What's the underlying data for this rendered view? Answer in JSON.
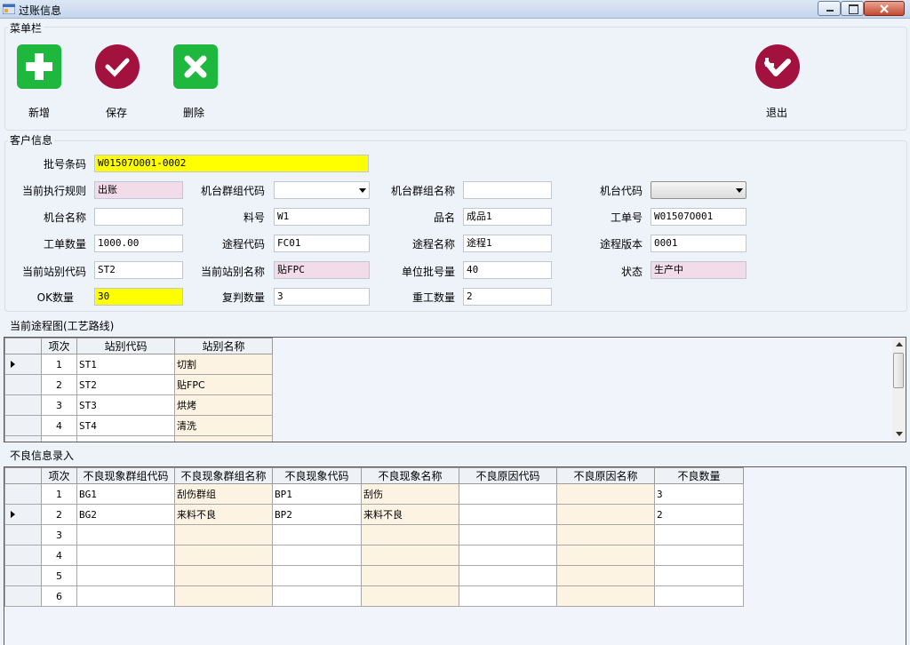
{
  "window": {
    "title": "过账信息"
  },
  "menu": {
    "group_label": "菜单栏",
    "add_label": "新增",
    "save_label": "保存",
    "delete_label": "删除",
    "exit_label": "退出"
  },
  "customer": {
    "group_label": "客户信息",
    "batch_barcode": {
      "label": "批号条码",
      "value": "W01507O001-0002"
    },
    "exec_rule": {
      "label": "当前执行规则",
      "value": "出账"
    },
    "machine_group_code": {
      "label": "机台群组代码",
      "value": ""
    },
    "machine_group_name": {
      "label": "机台群组名称",
      "value": ""
    },
    "machine_code": {
      "label": "机台代码",
      "value": ""
    },
    "machine_name": {
      "label": "机台名称",
      "value": ""
    },
    "part_no": {
      "label": "料号",
      "value": "W1"
    },
    "product_name": {
      "label": "品名",
      "value": "成品1"
    },
    "work_order": {
      "label": "工单号",
      "value": "W01507O001"
    },
    "order_qty": {
      "label": "工单数量",
      "value": "1000.00"
    },
    "route_code": {
      "label": "途程代码",
      "value": "FC01"
    },
    "route_name": {
      "label": "途程名称",
      "value": "途程1"
    },
    "route_version": {
      "label": "途程版本",
      "value": "0001"
    },
    "station_code": {
      "label": "当前站别代码",
      "value": "ST2"
    },
    "station_name": {
      "label": "当前站别名称",
      "value": "贴FPC"
    },
    "unit_batch_qty": {
      "label": "单位批号量",
      "value": "40"
    },
    "status": {
      "label": "状态",
      "value": "生产中"
    },
    "ok_qty": {
      "label": "OK数量",
      "value": "30"
    },
    "recheck_qty": {
      "label": "复判数量",
      "value": "3"
    },
    "rework_qty": {
      "label": "重工数量",
      "value": "2"
    }
  },
  "route_grid": {
    "group_label": "当前途程图(工艺路线)",
    "columns": [
      "项次",
      "站别代码",
      "站别名称"
    ],
    "rows": [
      {
        "seq": "1",
        "code": "ST1",
        "name": "切割"
      },
      {
        "seq": "2",
        "code": "ST2",
        "name": "贴FPC"
      },
      {
        "seq": "3",
        "code": "ST3",
        "name": "烘烤"
      },
      {
        "seq": "4",
        "code": "ST4",
        "name": "清洗"
      }
    ]
  },
  "defect_grid": {
    "group_label": "不良信息录入",
    "columns": [
      "项次",
      "不良现象群组代码",
      "不良现象群组名称",
      "不良现象代码",
      "不良现象名称",
      "不良原因代码",
      "不良原因名称",
      "不良数量"
    ],
    "rows": [
      {
        "seq": "1",
        "group_code": "BG1",
        "group_name": "刮伤群组",
        "code": "BP1",
        "name": "刮伤",
        "reason_code": "",
        "reason_name": "",
        "qty": "3"
      },
      {
        "seq": "2",
        "group_code": "BG2",
        "group_name": "来料不良",
        "code": "BP2",
        "name": "来料不良",
        "reason_code": "",
        "reason_name": "",
        "qty": "2"
      },
      {
        "seq": "3",
        "group_code": "",
        "group_name": "",
        "code": "",
        "name": "",
        "reason_code": "",
        "reason_name": "",
        "qty": ""
      },
      {
        "seq": "4",
        "group_code": "",
        "group_name": "",
        "code": "",
        "name": "",
        "reason_code": "",
        "reason_name": "",
        "qty": ""
      },
      {
        "seq": "5",
        "group_code": "",
        "group_name": "",
        "code": "",
        "name": "",
        "reason_code": "",
        "reason_name": "",
        "qty": ""
      },
      {
        "seq": "6",
        "group_code": "",
        "group_name": "",
        "code": "",
        "name": "",
        "reason_code": "",
        "reason_name": "",
        "qty": ""
      }
    ]
  },
  "colors": {
    "green": "#1fb83f",
    "maroon": "#a3123e",
    "highlight_yellow": "#ffff00",
    "readonly_pink": "#f2dcea"
  }
}
